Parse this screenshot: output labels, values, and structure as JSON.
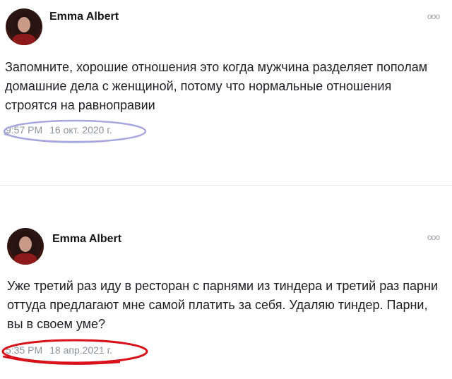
{
  "posts": [
    {
      "author": "Emma Albert",
      "text": "Запомните, хорошие отношения это когда мужчина разделяет пополам домашние дела с женщиной, потому что нормальные отношения строятся на равноправии",
      "time": "9:57 PM",
      "date": "16 окт. 2020 г.",
      "highlight_color": "#a7a7de"
    },
    {
      "author": "Emma Albert",
      "text": "Уже третий раз иду в ресторан с парнями из тиндера и третий раз парни оттуда предлагают мне самой платить за себя. Удаляю тиндер. Парни, вы в своем уме?",
      "time": "5:35 PM",
      "date": "18 апр.2021 г.",
      "highlight_color": "#d8101a"
    }
  ],
  "icons": {
    "more": "more-dots-icon"
  }
}
